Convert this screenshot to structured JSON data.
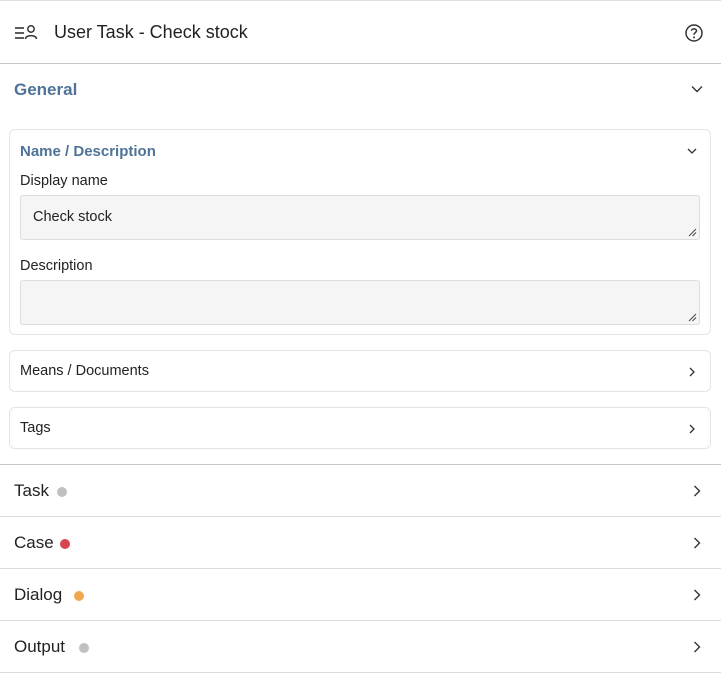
{
  "header": {
    "title": "User Task - Check stock",
    "type_icon": "user-task-icon",
    "help_icon": "help-circle-icon"
  },
  "general": {
    "title": "General",
    "name_description": {
      "title": "Name / Description",
      "display_name_label": "Display name",
      "display_name_value": "Check stock",
      "description_label": "Description",
      "description_value": ""
    },
    "means_documents_label": "Means / Documents",
    "tags_label": "Tags"
  },
  "sections": [
    {
      "label": "Task",
      "status_color": "#c0c0c0"
    },
    {
      "label": "Case",
      "status_color": "#d64550"
    },
    {
      "label": "Dialog",
      "status_color": "#f0a850"
    },
    {
      "label": "Output",
      "status_color": "#c0c0c0"
    }
  ]
}
